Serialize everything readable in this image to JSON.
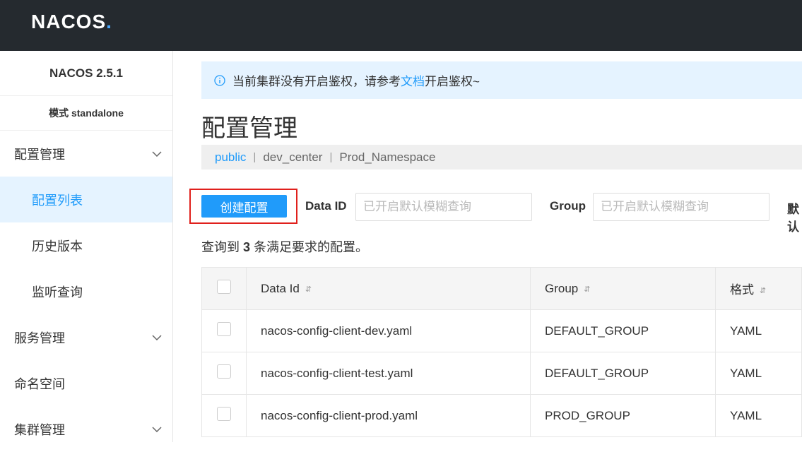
{
  "header": {
    "logo_text": "NACOS",
    "logo_dot": "."
  },
  "sidebar": {
    "version": "NACOS 2.5.1",
    "mode": "模式 standalone",
    "items": [
      {
        "label": "配置管理",
        "expandable": true
      },
      {
        "label": "配置列表",
        "active": true
      },
      {
        "label": "历史版本"
      },
      {
        "label": "监听查询"
      },
      {
        "label": "服务管理",
        "expandable": true
      },
      {
        "label": "命名空间"
      },
      {
        "label": "集群管理",
        "expandable": true
      }
    ]
  },
  "notice": {
    "before": "当前集群没有开启鉴权，请参考",
    "link": "文档",
    "after": "开启鉴权~"
  },
  "page_title": "配置管理",
  "namespaces": [
    "public",
    "dev_center",
    "Prod_Namespace"
  ],
  "namespace_separator": "|",
  "toolbar": {
    "create_label": "创建配置",
    "dataid_label": "Data ID",
    "dataid_placeholder": "已开启默认模糊查询",
    "group_label": "Group",
    "group_placeholder": "已开启默认模糊查询",
    "extra_label_partial": "默认"
  },
  "result": {
    "prefix": "查询到",
    "count": "3",
    "suffix": "条满足要求的配置。"
  },
  "table": {
    "columns": [
      "Data Id",
      "Group",
      "格式"
    ],
    "rows": [
      {
        "data_id": "nacos-config-client-dev.yaml",
        "group": "DEFAULT_GROUP",
        "format": "YAML"
      },
      {
        "data_id": "nacos-config-client-test.yaml",
        "group": "DEFAULT_GROUP",
        "format": "YAML"
      },
      {
        "data_id": "nacos-config-client-prod.yaml",
        "group": "PROD_GROUP",
        "format": "YAML"
      }
    ]
  },
  "colors": {
    "accent": "#209bfa",
    "header_bg": "#252a2f",
    "highlight_border": "#e0201c"
  }
}
